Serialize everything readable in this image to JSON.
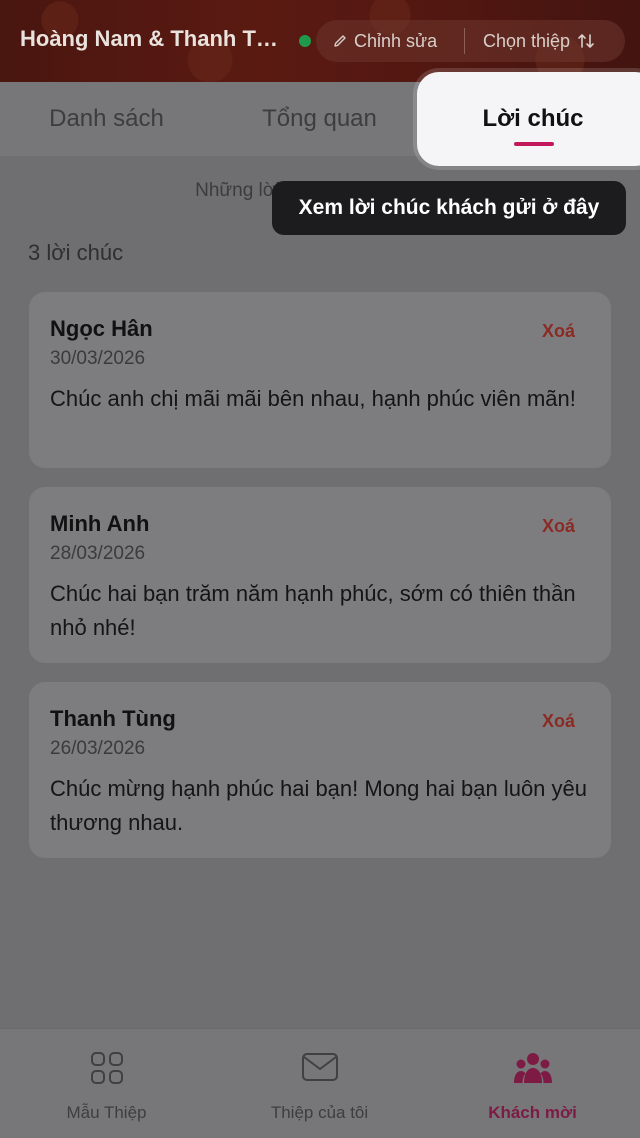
{
  "header": {
    "event_title": "Hoàng Nam & Thanh Tùng",
    "status_color": "#1f9a4d",
    "edit_label": "Chỉnh sửa",
    "edit_icon": "pencil-icon",
    "pick_label": "Chọn thiệp",
    "pick_icon": "swap-vertical-icon"
  },
  "tabs": [
    {
      "label": "Danh sách"
    },
    {
      "label": "Tổng quan"
    },
    {
      "label": "Lời chúc",
      "active": true
    }
  ],
  "intro_text": "Những lời chúc",
  "tooltip": "Xem lời chúc khách gửi ở đây",
  "count_text": "3 lời chúc",
  "wishes": [
    {
      "name": "Ngọc Hân",
      "date": "30/03/2026",
      "message": "Chúc anh chị mãi mãi bên nhau, hạnh phúc viên mãn!",
      "delete_label": "Xoá"
    },
    {
      "name": "Minh Anh",
      "date": "28/03/2026",
      "message": "Chúc hai bạn trăm năm hạnh phúc, sớm có thiên thần nhỏ nhé!",
      "delete_label": "Xoá"
    },
    {
      "name": "Thanh Tùng",
      "date": "26/03/2026",
      "message": "Chúc mừng hạnh phúc hai bạn! Mong hai bạn luôn yêu thương nhau.",
      "delete_label": "Xoá"
    }
  ],
  "bottom_nav": [
    {
      "label": "Mẫu Thiệp",
      "icon": "grid-icon"
    },
    {
      "label": "Thiệp của tôi",
      "icon": "envelope-icon"
    },
    {
      "label": "Khách mời",
      "icon": "people-icon",
      "active": true
    }
  ],
  "colors": {
    "accent": "#c2185b",
    "delete": "#8c2a24",
    "header_bg": "#521711"
  }
}
